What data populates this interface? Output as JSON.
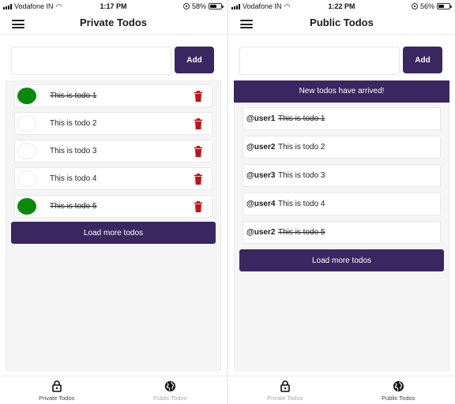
{
  "colors": {
    "brand_purple": "#3a2660",
    "done_green": "#0a8a0a",
    "trash_red": "#c4121a",
    "panel_bg": "#f5f5f5"
  },
  "screens": [
    {
      "status": {
        "carrier": "Vodafone IN",
        "time": "1:17 PM",
        "battery": "58%",
        "battery_level": 0.58
      },
      "header": {
        "title": "Private Todos",
        "menu_icon": "hamburger-menu-icon"
      },
      "input": {
        "value": "",
        "placeholder": "",
        "add_label": "Add"
      },
      "todos": [
        {
          "text": "This is todo 1",
          "completed": true
        },
        {
          "text": "This is todo 2",
          "completed": false
        },
        {
          "text": "This is todo 3",
          "completed": false
        },
        {
          "text": "This is todo 4",
          "completed": false
        },
        {
          "text": "This is todo 5",
          "completed": true
        }
      ],
      "load_more_label": "Load more todos",
      "tabs": [
        {
          "label": "Private Todos",
          "icon": "lock-icon",
          "active": true
        },
        {
          "label": "Public Todos",
          "icon": "globe-icon",
          "active": false
        }
      ]
    },
    {
      "status": {
        "carrier": "Vodafone IN",
        "time": "1:22 PM",
        "battery": "56%",
        "battery_level": 0.56
      },
      "header": {
        "title": "Public Todos",
        "menu_icon": "hamburger-menu-icon"
      },
      "input": {
        "value": "",
        "placeholder": "",
        "add_label": "Add"
      },
      "banner": "New todos have arrived!",
      "todos": [
        {
          "user": "@user1",
          "text": "This is todo 1",
          "completed": true
        },
        {
          "user": "@user2",
          "text": "This is todo 2",
          "completed": false
        },
        {
          "user": "@user3",
          "text": "This is todo 3",
          "completed": false
        },
        {
          "user": "@user4",
          "text": "This is todo 4",
          "completed": false
        },
        {
          "user": "@user2",
          "text": "This is todo 5",
          "completed": true
        }
      ],
      "load_more_label": "Load more todos",
      "tabs": [
        {
          "label": "Private Todos",
          "icon": "lock-icon",
          "active": false
        },
        {
          "label": "Public Todos",
          "icon": "globe-icon",
          "active": true
        }
      ]
    }
  ]
}
